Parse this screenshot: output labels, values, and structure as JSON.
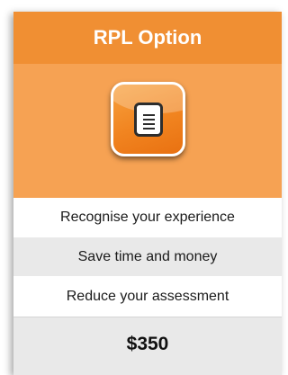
{
  "card": {
    "title": "RPL Option",
    "icon": "document-icon",
    "features": [
      "Recognise your experience",
      "Save time and money",
      "Reduce your assessment"
    ],
    "price": "$350"
  },
  "colors": {
    "header": "#f08f33",
    "hero": "#f6a253",
    "icon_orange": "#f18420",
    "row_grey": "#e9e9e9",
    "row_white": "#ffffff"
  }
}
